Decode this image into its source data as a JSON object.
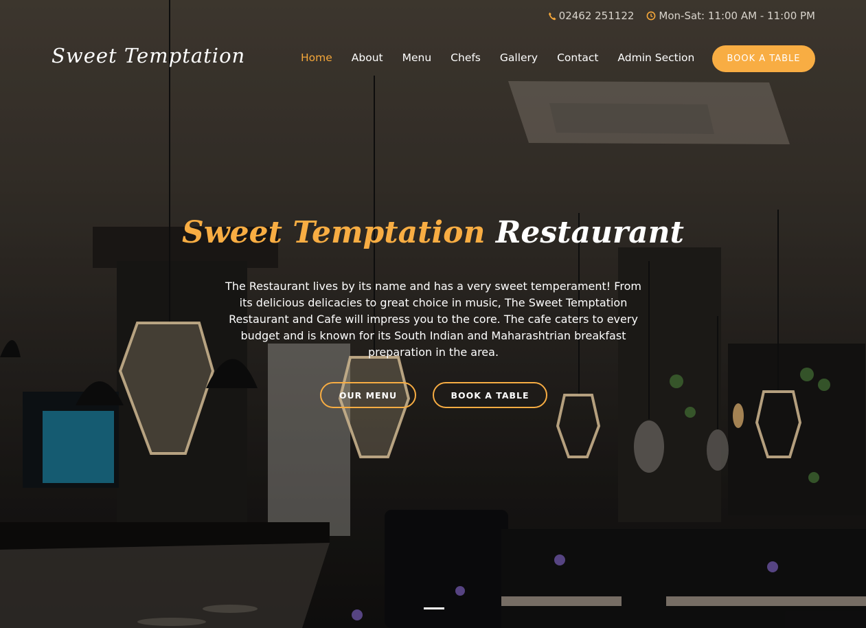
{
  "topbar": {
    "phone": "02462 251122",
    "hours": "Mon-Sat: 11:00 AM - 11:00 PM",
    "phone_icon": "phone-icon",
    "clock_icon": "clock-icon"
  },
  "header": {
    "logo": "Sweet Temptation",
    "nav": [
      {
        "label": "Home",
        "active": true
      },
      {
        "label": "About"
      },
      {
        "label": "Menu"
      },
      {
        "label": "Chefs"
      },
      {
        "label": "Gallery"
      },
      {
        "label": "Contact"
      },
      {
        "label": "Admin Section"
      }
    ],
    "book_button": "BOOK A TABLE"
  },
  "hero": {
    "title_part1": "Sweet Temptation",
    "title_part2": "Restaurant",
    "description": "The Restaurant lives by its name and has a very sweet temperament! From its delicious delicacies to great choice in music, The Sweet Temptation Restaurant and Cafe will impress you to the core. The cafe caters to every budget and is known for its South Indian and Maharashtrian breakfast preparation in the area.",
    "btn_menu": "OUR MENU",
    "btn_book": "BOOK A TABLE"
  },
  "colors": {
    "accent": "#f8ad43",
    "text": "#ffffff"
  }
}
